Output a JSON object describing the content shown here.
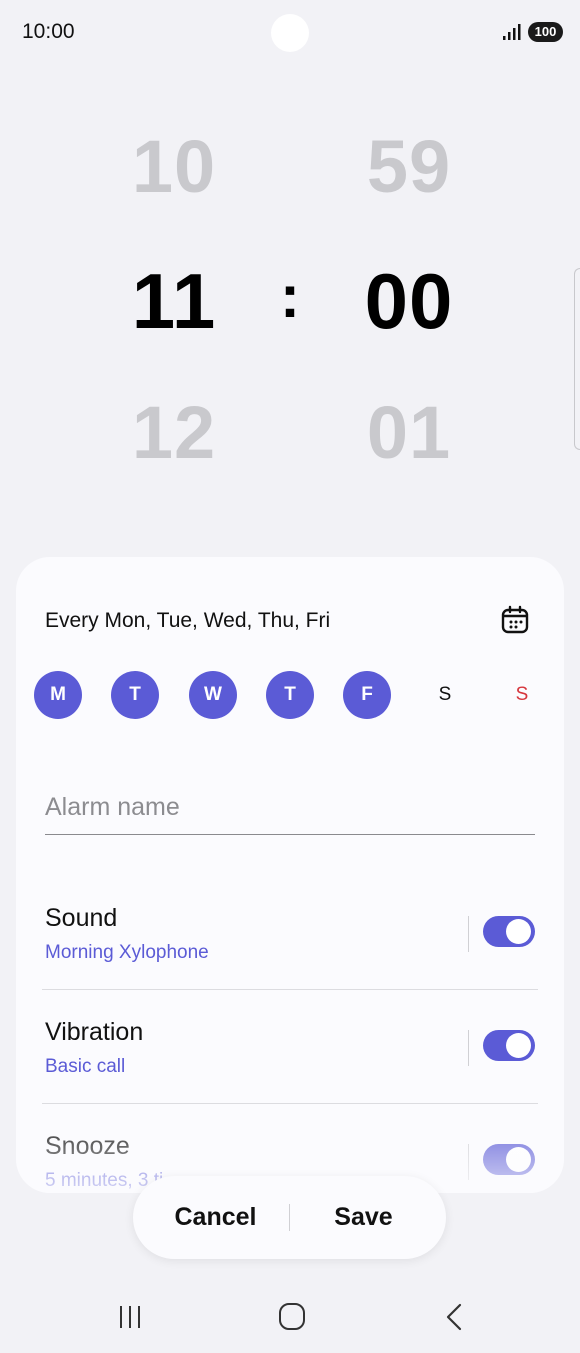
{
  "status_bar": {
    "time": "10:00",
    "battery": "100",
    "icons": [
      "signal-icon",
      "battery-icon"
    ]
  },
  "time_picker": {
    "hour_prev": "10",
    "hour": "11",
    "hour_next": "12",
    "separator": ":",
    "minute_prev": "59",
    "minute": "00",
    "minute_next": "01"
  },
  "repeat": {
    "text": "Every Mon, Tue, Wed, Thu, Fri",
    "calendar_icon": "calendar-icon",
    "days": [
      {
        "label": "M",
        "selected": true
      },
      {
        "label": "T",
        "selected": true
      },
      {
        "label": "W",
        "selected": true
      },
      {
        "label": "T",
        "selected": true
      },
      {
        "label": "F",
        "selected": true
      },
      {
        "label": "S",
        "selected": false
      },
      {
        "label": "S",
        "selected": false
      }
    ]
  },
  "alarm_name": {
    "value": "",
    "placeholder": "Alarm name"
  },
  "settings": [
    {
      "title": "Sound",
      "subtitle": "Morning Xylophone",
      "enabled": true
    },
    {
      "title": "Vibration",
      "subtitle": "Basic call",
      "enabled": true
    },
    {
      "title": "Snooze",
      "subtitle": "5 minutes, 3 ti",
      "enabled": true
    }
  ],
  "actions": {
    "cancel": "Cancel",
    "save": "Save"
  },
  "colors": {
    "accent": "#5b5bd6",
    "sunday": "#d6363d",
    "background": "#f2f2f6",
    "card": "#fbfbfe"
  },
  "nav_bar": {
    "icons": [
      "recent-apps-icon",
      "home-icon",
      "back-icon"
    ]
  }
}
